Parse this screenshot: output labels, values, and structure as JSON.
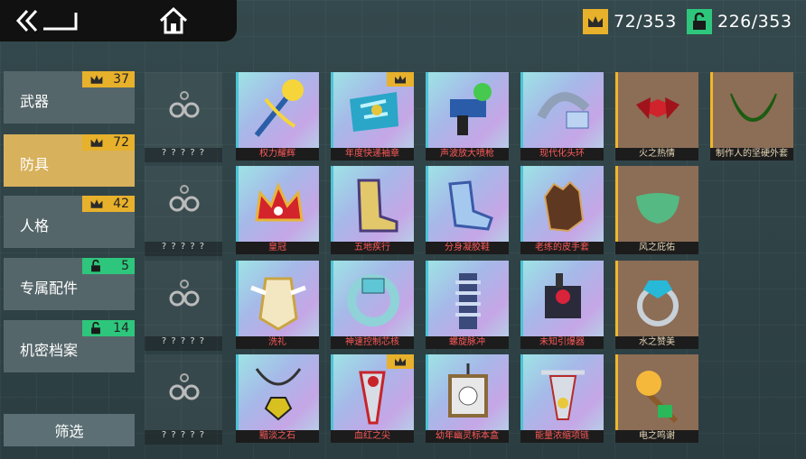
{
  "counters": {
    "crowns": "72/353",
    "unlocked": "226/353"
  },
  "sidebar": [
    {
      "label": "武器",
      "badge": "37",
      "badge_type": "crown"
    },
    {
      "label": "防具",
      "badge": "72",
      "badge_type": "crown",
      "active": true
    },
    {
      "label": "人格",
      "badge": "42",
      "badge_type": "crown"
    },
    {
      "label": "专属配件",
      "badge": "5",
      "badge_type": "lock"
    },
    {
      "label": "机密档案",
      "badge": "14",
      "badge_type": "lock"
    }
  ],
  "filter_label": "筛选",
  "locked_placeholder": "? ? ? ? ?",
  "grid": [
    [
      {
        "name": "权力耀辉",
        "icon": "scepter-icon"
      },
      {
        "name": "年度快递袖章",
        "icon": "armband-icon",
        "crown": true
      },
      {
        "name": "声波放大喷枪",
        "icon": "sonic-gun-icon"
      },
      {
        "name": "现代化头环",
        "icon": "headset-icon"
      },
      {
        "name": "火之热情",
        "icon": "red-bow-icon",
        "gold": true
      },
      {
        "name": "制作人的坚硬外套",
        "icon": "green-collar-icon",
        "gold": true
      }
    ],
    [
      {
        "name": "皇冠",
        "icon": "crown-item-icon"
      },
      {
        "name": "五地疾行",
        "icon": "golden-boots-icon"
      },
      {
        "name": "分身凝胶鞋",
        "icon": "gel-boot-icon"
      },
      {
        "name": "老练的皮手套",
        "icon": "leather-glove-icon"
      },
      {
        "name": "风之庇佑",
        "icon": "green-mask-icon",
        "gold": true
      }
    ],
    [
      {
        "name": "洗礼",
        "icon": "angel-armor-icon"
      },
      {
        "name": "神速控制芯核",
        "icon": "core-ring-icon"
      },
      {
        "name": "螺旋脉冲",
        "icon": "spiral-device-icon"
      },
      {
        "name": "未知引爆器",
        "icon": "detonator-icon"
      },
      {
        "name": "水之赞美",
        "icon": "blue-gem-ring-icon",
        "gold": true
      }
    ],
    [
      {
        "name": "黯淡之石",
        "icon": "stone-necklace-icon"
      },
      {
        "name": "血红之尖",
        "icon": "red-spike-icon",
        "crown": true
      },
      {
        "name": "幼年幽灵标本盒",
        "icon": "ghost-box-icon"
      },
      {
        "name": "能量浓缩项链",
        "icon": "energy-necklace-icon"
      },
      {
        "name": "电之鸣谢",
        "icon": "lightning-scepter-icon",
        "gold": true
      }
    ]
  ]
}
